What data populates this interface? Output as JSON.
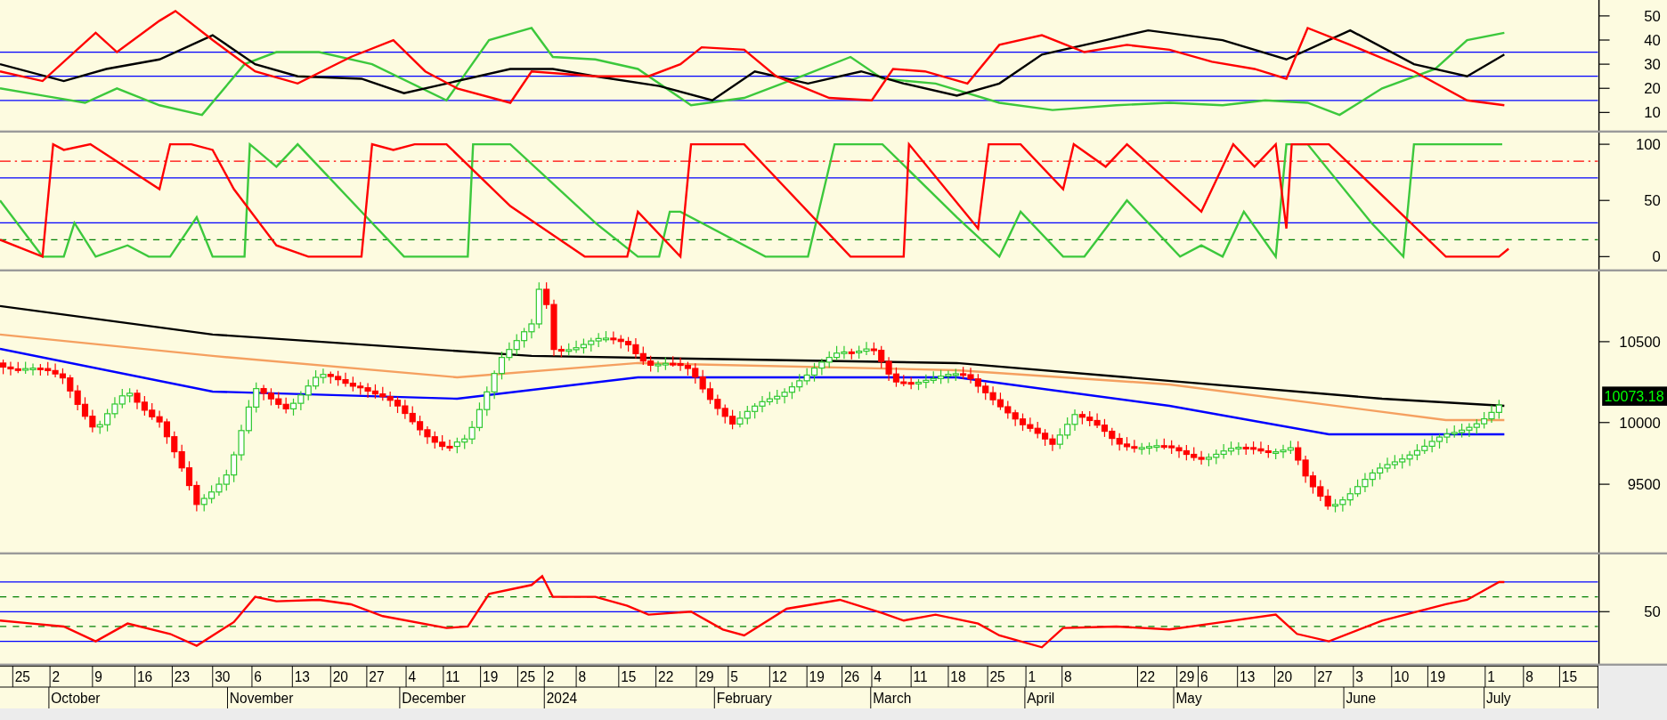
{
  "panels": [
    {
      "kind": "dmi",
      "yticks": [
        "50",
        "40",
        "30",
        "20",
        "10"
      ]
    },
    {
      "kind": "aroon",
      "yticks": [
        "100",
        "50",
        "0"
      ]
    },
    {
      "kind": "price",
      "yticks": [
        "10500",
        "10000",
        "9500"
      ],
      "last_price": "10073.18"
    },
    {
      "kind": "rsi",
      "yticks": [
        "50"
      ]
    }
  ],
  "time_axis": {
    "weeks": [
      "25",
      "2",
      "9",
      "16",
      "23",
      "30",
      "6",
      "13",
      "20",
      "27",
      "4",
      "11",
      "19",
      "25",
      "2",
      "8",
      "15",
      "22",
      "29",
      "5",
      "12",
      "19",
      "26",
      "4",
      "11",
      "18",
      "25",
      "1",
      "8",
      "22",
      "29",
      "6",
      "13",
      "20",
      "27",
      "3",
      "10",
      "19",
      "1",
      "8",
      "15"
    ],
    "months": [
      "October",
      "November",
      "December",
      "2024",
      "February",
      "March",
      "April",
      "May",
      "June",
      "July"
    ]
  }
}
